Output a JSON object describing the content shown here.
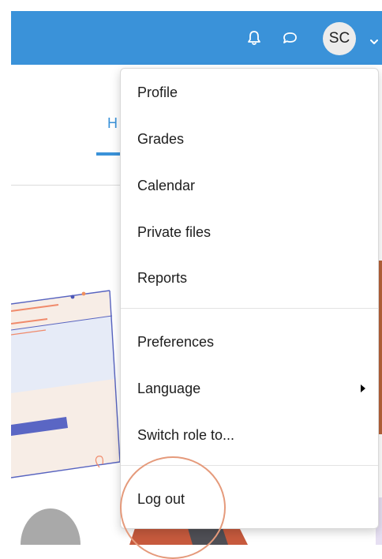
{
  "header": {
    "avatar_initials": "SC",
    "icons": {
      "notifications": "bell-icon",
      "messages": "chat-bubble-icon",
      "user_menu_caret": "chevron-down-icon"
    },
    "colors": {
      "navbar": "#3a92d9",
      "avatar_bg": "#ececec"
    }
  },
  "page": {
    "active_tab_label": "H"
  },
  "user_menu": {
    "groups": [
      [
        "Profile",
        "Grades",
        "Calendar",
        "Private files",
        "Reports"
      ],
      [
        "Preferences",
        "Language",
        "Switch role to..."
      ],
      [
        "Log out"
      ]
    ],
    "language_has_submenu": true,
    "highlighted_item": "Log out",
    "highlight_color": "#e59a7b"
  }
}
